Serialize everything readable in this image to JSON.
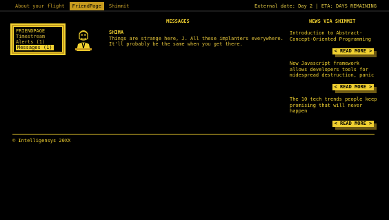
{
  "nav": {
    "items": [
      "About your flight",
      "FriendPage",
      "Shimmit"
    ],
    "active_index": 1
  },
  "status": "External date: Day 2 | ETA: DAYS REMAINING",
  "sidebar": {
    "title": "FRIENDPAGE",
    "items": [
      "Timestream",
      "Alerts (1)",
      "Messages (1)"
    ],
    "active_index": 2
  },
  "messages": {
    "title": "MESSAGES",
    "items": [
      {
        "sender": "SHIMA",
        "text": "Things are strange here, J. All these implanters everywhere. It'll probably be the same when you get there."
      }
    ]
  },
  "news": {
    "title": "NEWS VIA SHIMMIT",
    "read_more_label": "< READ MORE >",
    "items": [
      "Introduction to Abstract-Concept-Oriented Programming",
      "New Javascript framework allows developers tools for midespread destruction, panic",
      "The 10 tech trends people keep promising that will never happen"
    ]
  },
  "footer": "© Intelligensys 20XX",
  "colors": {
    "accent": "#f2d230",
    "accent_dark": "#c79b1e",
    "background": "#000000"
  }
}
